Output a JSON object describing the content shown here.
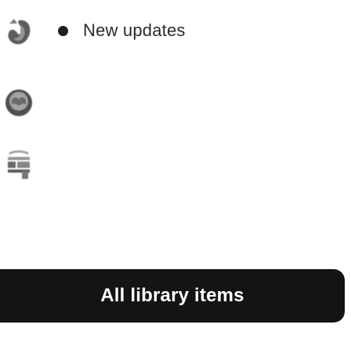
{
  "updates": {
    "label": "New updates",
    "dot_icon": "filled-dot-icon"
  },
  "icons": {
    "first": "book-cover-thumbnail-icon",
    "second": "round-book-cover-thumbnail-icon",
    "third": "library-shelf-thumbnail-icon"
  },
  "library_button": {
    "label": "All library items"
  },
  "colors": {
    "button_background": "#141414",
    "button_text": "#ffffff",
    "text": "#2b2b2b"
  }
}
